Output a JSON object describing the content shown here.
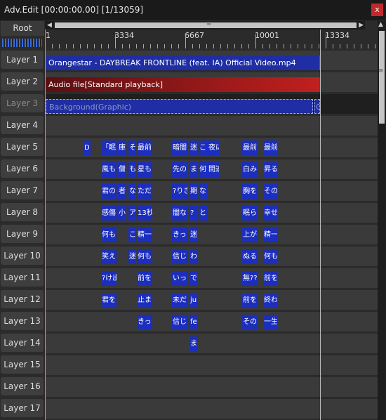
{
  "window": {
    "title": "Adv.Edit [00:00:00.00] [1/13059]",
    "close": "x"
  },
  "root_label": "Root",
  "ruler": {
    "labels": [
      "1",
      "3334",
      "6667",
      "10001",
      "13334"
    ]
  },
  "layers": [
    "Layer 1",
    "Layer 2",
    "Layer 3",
    "Layer 4",
    "Layer 5",
    "Layer 6",
    "Layer 7",
    "Layer 8",
    "Layer 9",
    "Layer 10",
    "Layer 11",
    "Layer 12",
    "Layer 13",
    "Layer 14",
    "Layer 15",
    "Layer 16",
    "Layer 17"
  ],
  "clips": {
    "video": "Orangestar - DAYBREAK FRONTLINE (feat. IA) Official Video.mp4",
    "audio": "Audio file[Standard playback]",
    "background": "Background(Graphic)",
    "background_tail": "G"
  },
  "text_clips": [
    [
      "D",
      "「眠",
      "庫",
      "そ",
      "最前",
      "暗闇",
      "迷",
      "こ",
      "夜に",
      "最前",
      "最前"
    ],
    [
      "風も",
      "僧",
      "も",
      "星も",
      "先の",
      "ま",
      "何",
      "間違",
      "白み",
      "昇る"
    ],
    [
      "君の",
      "者",
      "な",
      "ただ",
      "?りき",
      "期",
      "な",
      "胸を",
      "その"
    ],
    [
      "感傷",
      "小",
      "ア",
      "13秒",
      "闇な",
      "?",
      "と",
      "眠ら",
      "幸せ"
    ],
    [
      "何も",
      "こ",
      "精一",
      "きっ",
      "迷",
      "上が",
      "精一"
    ],
    [
      "笑え",
      "迷",
      "何も",
      "信じ",
      "わ",
      "ぬる",
      "何も"
    ],
    [
      "?け出",
      "前を",
      "いっ",
      "で",
      "無??",
      "前を"
    ],
    [
      "君を",
      "止ま",
      "未だ",
      "ju",
      "前を",
      "終わ"
    ],
    [
      "きっと",
      "信じ",
      "fe",
      "その",
      "一生"
    ],
    [
      "ま"
    ]
  ],
  "colors": {
    "cursor": "#2ad0d0",
    "clip_blue": "#1c2ebc",
    "audio_red": "#c1201e",
    "close_red": "#c0282c"
  }
}
